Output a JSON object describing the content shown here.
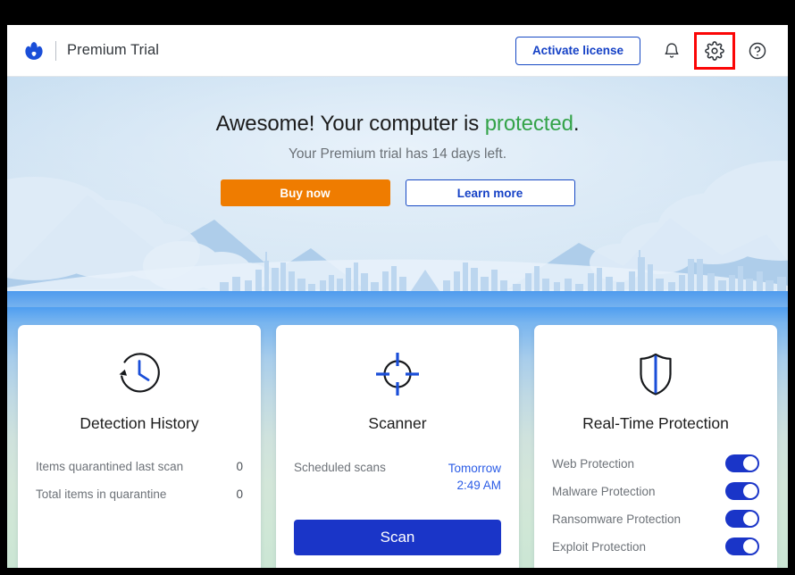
{
  "window": {
    "border_color": "#000000"
  },
  "header": {
    "logo_icon": "malwarebytes-logo-icon",
    "product_title": "Premium Trial",
    "activate_label": "Activate license",
    "bell_icon": "notification-bell-icon",
    "gear_icon": "settings-gear-icon",
    "help_icon": "help-question-icon",
    "highlight_color": "#fb0606",
    "brand_color": "#1a4ed8"
  },
  "hero": {
    "headline_prefix": "Awesome! Your computer is ",
    "headline_status": "protected",
    "headline_suffix": ".",
    "status_color": "#34a349",
    "subline": "Your Premium trial has 14 days left.",
    "buy_label": "Buy now",
    "buy_color": "#ef7c00",
    "learn_label": "Learn more",
    "learn_color": "#1541c6"
  },
  "cards": {
    "detection": {
      "icon": "clock-history-icon",
      "title": "Detection History",
      "stats": [
        {
          "label": "Items quarantined last scan",
          "value": "0"
        },
        {
          "label": "Total items in quarantine",
          "value": "0"
        }
      ]
    },
    "scanner": {
      "icon": "crosshair-target-icon",
      "title": "Scanner",
      "scheduled_label": "Scheduled scans",
      "scheduled_day": "Tomorrow",
      "scheduled_time": "2:49 AM",
      "scheduled_color": "#2b5ce6",
      "scan_label": "Scan",
      "scan_color": "#1a35c8"
    },
    "protection": {
      "icon": "shield-protection-icon",
      "title": "Real-Time Protection",
      "toggle_on_color": "#1a35c8",
      "items": [
        {
          "label": "Web Protection",
          "state": "on"
        },
        {
          "label": "Malware Protection",
          "state": "on"
        },
        {
          "label": "Ransomware Protection",
          "state": "on"
        },
        {
          "label": "Exploit Protection",
          "state": "on"
        }
      ]
    }
  }
}
